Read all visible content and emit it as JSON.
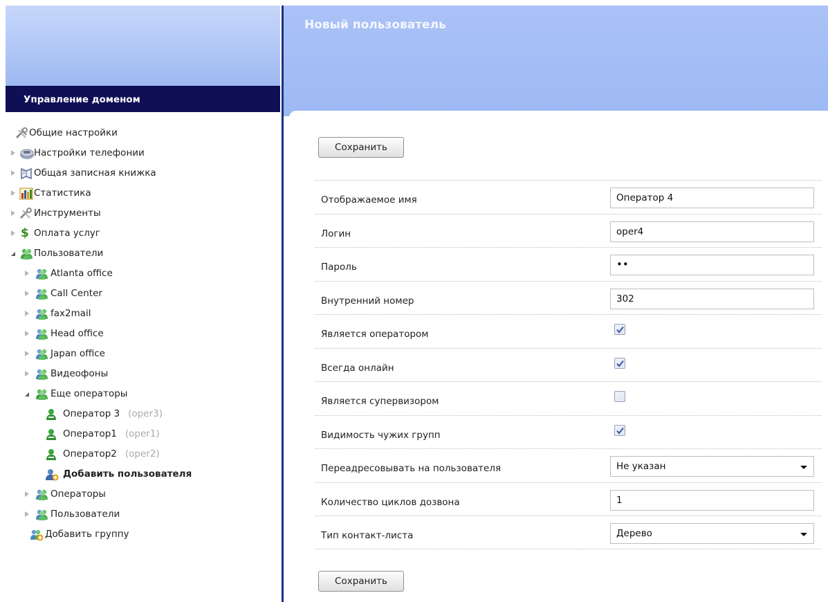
{
  "sidebar": {
    "title": "Управление доменом",
    "items": [
      {
        "label": "Общие настройки",
        "icon": "tools-icon"
      },
      {
        "label": "Настройки телефонии",
        "icon": "phone-icon"
      },
      {
        "label": "Общая записная книжка",
        "icon": "address-book-icon"
      },
      {
        "label": "Статистика",
        "icon": "statistics-icon"
      },
      {
        "label": "Инструменты",
        "icon": "tools-icon"
      },
      {
        "label": "Оплата услуг",
        "icon": "dollar-icon"
      },
      {
        "label": "Пользователи",
        "icon": "users-group-icon"
      },
      {
        "label": "Atlanta office",
        "icon": "users-group-icon"
      },
      {
        "label": "Call Center",
        "icon": "users-group-icon"
      },
      {
        "label": "fax2mail",
        "icon": "users-group-icon"
      },
      {
        "label": "Head office",
        "icon": "users-group-icon"
      },
      {
        "label": "Japan office",
        "icon": "users-group-icon"
      },
      {
        "label": "Видеофоны",
        "icon": "users-group-icon"
      },
      {
        "label": "Еще операторы",
        "icon": "users-group-icon"
      },
      {
        "label": "Оператор 3",
        "sub": "(oper3)",
        "icon": "user-icon"
      },
      {
        "label": "Оператор1",
        "sub": "(oper1)",
        "icon": "user-icon"
      },
      {
        "label": "Оператор2",
        "sub": "(oper2)",
        "icon": "user-icon"
      },
      {
        "label": "Добавить пользователя",
        "icon": "add-user-icon"
      },
      {
        "label": "Операторы",
        "icon": "users-group-icon"
      },
      {
        "label": "Пользователи",
        "icon": "users-group-icon"
      },
      {
        "label": "Добавить группу",
        "icon": "add-group-icon"
      }
    ]
  },
  "page": {
    "title": "Новый пользователь",
    "save_label": "Сохранить"
  },
  "form": {
    "display_name": {
      "label": "Отображаемое имя",
      "value": "Оператор 4"
    },
    "login": {
      "label": "Логин",
      "value": "oper4"
    },
    "password": {
      "label": "Пароль",
      "value": "••"
    },
    "extension": {
      "label": "Внутренний номер",
      "value": "302"
    },
    "is_operator": {
      "label": "Является оператором",
      "checked": true
    },
    "always_online": {
      "label": "Всегда онлайн",
      "checked": true
    },
    "is_supervisor": {
      "label": "Является супервизором",
      "checked": false
    },
    "foreign_groups": {
      "label": "Видимость чужих групп",
      "checked": true
    },
    "forward_to": {
      "label": "Переадресовывать на пользователя",
      "value": "Не указан"
    },
    "ring_cycles": {
      "label": "Количество циклов дозвона",
      "value": "1"
    },
    "contact_list_type": {
      "label": "Тип контакт-листа",
      "value": "Дерево"
    }
  },
  "colors": {
    "header_blue": "#9db8f4",
    "title_bar": "#0f0f55",
    "separator": "#1b2f83"
  }
}
